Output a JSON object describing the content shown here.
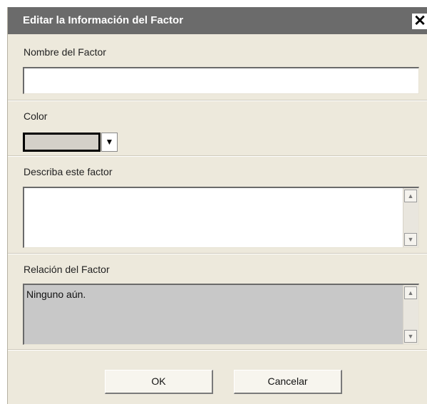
{
  "dialog": {
    "title": "Editar la Información del Factor",
    "close_symbol": "✕"
  },
  "fields": {
    "name_label": "Nombre del Factor",
    "name_value": "",
    "color_label": "Color",
    "color_value": "#d4d0c8",
    "description_label": "Describa este factor",
    "description_value": "",
    "relation_label": "Relación del Factor",
    "relation_value": "Ninguno aún."
  },
  "icons": {
    "close": "close-icon",
    "dropdown": "chevron-down-icon",
    "scroll_up": "arrow-up-icon",
    "scroll_down": "arrow-down-icon"
  },
  "buttons": {
    "ok_label": "OK",
    "cancel_label": "Cancelar"
  }
}
